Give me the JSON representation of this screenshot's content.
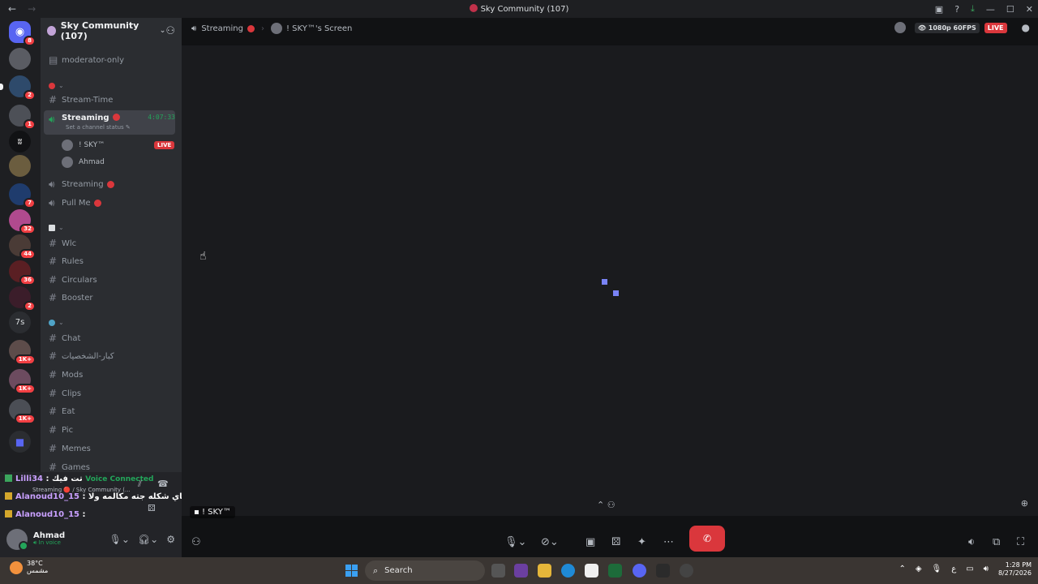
{
  "window": {
    "title": "Sky Community (107)",
    "back_icon": "arrow-left-icon",
    "forward_icon": "arrow-right-icon"
  },
  "servers": [
    {
      "badge": "8",
      "icon": "discord-home-icon"
    },
    {
      "badge": ""
    },
    {
      "badge": "2"
    },
    {
      "badge": "1"
    },
    {
      "badge": ""
    },
    {
      "badge": ""
    },
    {
      "badge": "7"
    },
    {
      "badge": "32"
    },
    {
      "badge": "44"
    },
    {
      "badge": "36"
    },
    {
      "badge": "2"
    },
    {
      "badge": "",
      "label": "7s"
    },
    {
      "badge": "1K+"
    },
    {
      "badge": "1K+"
    },
    {
      "badge": "1K+"
    },
    {
      "badge": ""
    }
  ],
  "sidebar": {
    "guild_name": "Sky Community (107)",
    "channels": {
      "moderator_only": "moderator-only",
      "stream_time": "Stream-Time",
      "streaming_active": "Streaming",
      "streaming_timer": "4:07:33",
      "channel_status": "Set a channel status",
      "voice_user_1": "! SKY™",
      "voice_user_1_badge": "LIVE",
      "voice_user_2": "Ahmad",
      "streaming_2": "Streaming",
      "pull_me": "Pull Me",
      "wlc": "Wlc",
      "rules": "Rules",
      "circulars": "Circulars",
      "booster": "Booster",
      "chat": "Chat",
      "kbar": "كبار-الشخصيات",
      "mods": "Mods",
      "clips": "Clips",
      "eat": "Eat",
      "pic": "Pic",
      "memes": "Memes",
      "games": "Games"
    }
  },
  "voice_panel": {
    "msg1_user": "Lilli34",
    "msg1_body": ": تت فيك",
    "connected": "Voice Connected",
    "voice_sub": "Streaming 🔴 / Sky Community (...",
    "msg2_user": "Alanoud10_15",
    "msg2_body": ": سكاي شكله جته مكالمه ولا",
    "msg3_user": "Alanoud10_15",
    "msg3_body": ":"
  },
  "user": {
    "name": "Ahmad",
    "status": "In voice"
  },
  "stage": {
    "channel": "Streaming",
    "screen_title": "! SKY™'s Screen",
    "quality": "1080p 60FPS",
    "live": "LIVE",
    "streamer_tag": "! SKY™"
  },
  "taskbar": {
    "temp": "38°C",
    "weather_desc": "مشمس",
    "search_placeholder": "Search",
    "lang": "ع",
    "time": "1:28 PM",
    "date": "8/27/2026"
  }
}
